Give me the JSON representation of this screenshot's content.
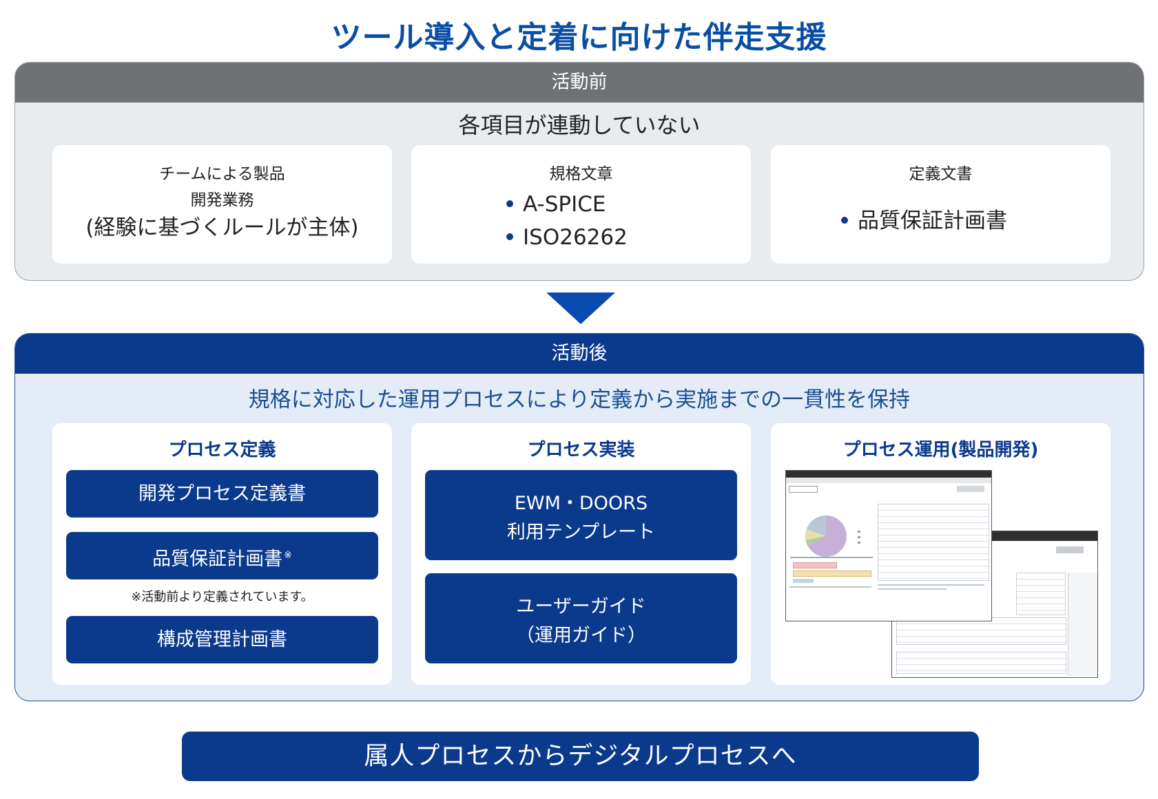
{
  "title": "ツール導入と定着に向けた伴走支援",
  "before": {
    "header": "活動前",
    "subtitle": "各項目が連動していない",
    "cards": [
      {
        "lines": [
          "チームによる製品",
          "開発業務",
          "(経験に基づくルールが主体)"
        ]
      },
      {
        "heading": "規格文章",
        "bullets": [
          "A-SPICE",
          "ISO26262"
        ]
      },
      {
        "heading": "定義文書",
        "bullets": [
          "品質保証計画書"
        ]
      }
    ]
  },
  "after": {
    "header": "活動後",
    "subtitle": "規格に対応した運用プロセスにより定義から実施までの一貫性を保持",
    "cards": [
      {
        "title": "プロセス定義",
        "buttons": [
          "開発プロセス定義書",
          "品質保証計画書",
          "構成管理計画書"
        ],
        "asterisk": "※",
        "note": "※活動前より定義されています。"
      },
      {
        "title": "プロセス実装",
        "buttons": [
          {
            "line1": "EWM・DOORS",
            "line2": "利用テンプレート"
          },
          {
            "line1": "ユーザーガイド",
            "line2": "（運用ガイド）"
          }
        ]
      },
      {
        "title": "プロセス運用(製品開発)"
      }
    ]
  },
  "footer": "属人プロセスからデジタルプロセスへ",
  "colors": {
    "brand_blue": "#0b3a8c",
    "title_blue": "#0a4ea4",
    "gray_header": "#6e7275"
  }
}
